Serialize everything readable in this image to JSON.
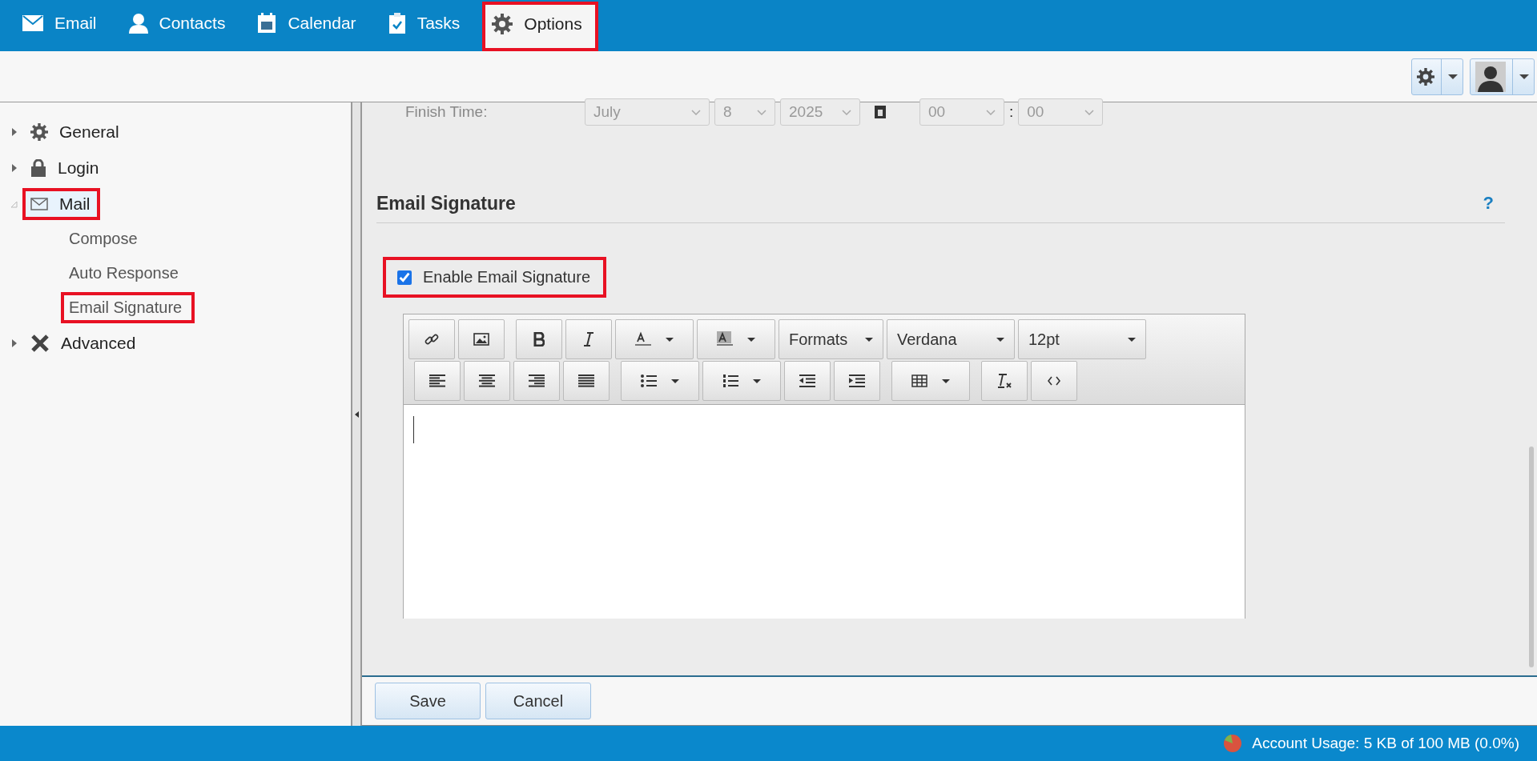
{
  "nav": {
    "tabs": [
      {
        "label": "Email",
        "selected": false,
        "highlighted": false
      },
      {
        "label": "Contacts",
        "selected": false,
        "highlighted": false
      },
      {
        "label": "Calendar",
        "selected": false,
        "highlighted": false
      },
      {
        "label": "Tasks",
        "selected": false,
        "highlighted": false
      },
      {
        "label": "Options",
        "selected": true,
        "highlighted": true
      }
    ]
  },
  "sidebar": {
    "items": [
      {
        "label": "General",
        "expanded": false,
        "selected": false,
        "highlighted": false
      },
      {
        "label": "Login",
        "expanded": false,
        "selected": false,
        "highlighted": false
      },
      {
        "label": "Mail",
        "expanded": true,
        "selected": true,
        "highlighted": true,
        "children": [
          {
            "label": "Compose",
            "selected": false,
            "highlighted": false
          },
          {
            "label": "Auto Response",
            "selected": false,
            "highlighted": false
          },
          {
            "label": "Email Signature",
            "selected": true,
            "highlighted": true
          }
        ]
      },
      {
        "label": "Advanced",
        "expanded": false,
        "selected": false,
        "highlighted": false
      }
    ]
  },
  "finish_time": {
    "label": "Finish Time:",
    "disabled": true,
    "month": "July",
    "day": "8",
    "year": "2025",
    "hour": "00",
    "separator": ":",
    "minute": "00"
  },
  "section": {
    "title": "Email Signature",
    "help": "?"
  },
  "enable_signature": {
    "label": "Enable Email Signature",
    "checked": true,
    "highlighted": true
  },
  "editor": {
    "formats": "Formats",
    "font": "Verdana",
    "size": "12pt"
  },
  "buttons": [
    "Save",
    "Cancel"
  ],
  "status_bar": {
    "usage": "Account Usage: 5 KB of 100 MB (0.0%)"
  }
}
